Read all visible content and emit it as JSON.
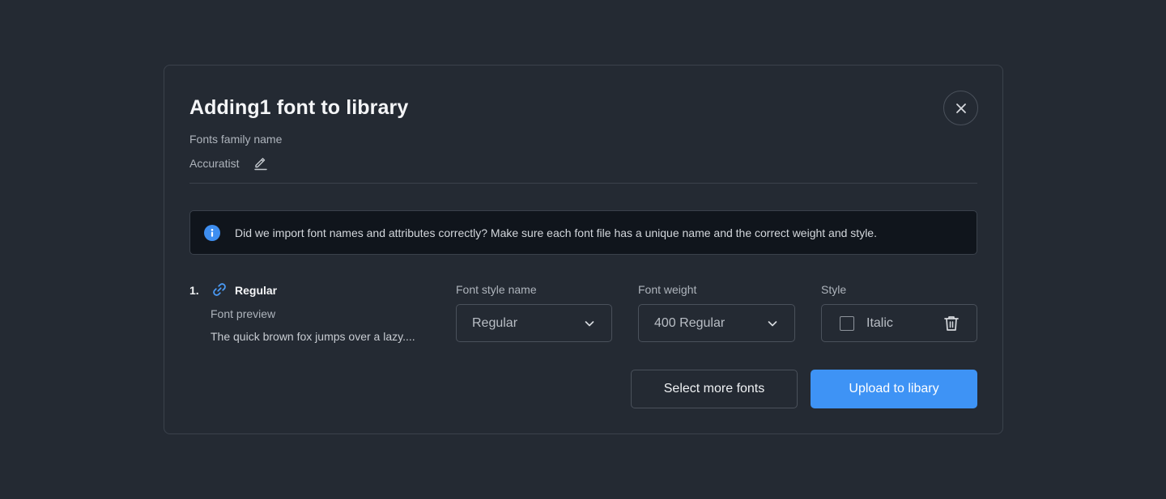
{
  "modal": {
    "title": "Adding1 font to library",
    "close_icon": "close-icon"
  },
  "family": {
    "label": "Fonts family name",
    "name": "Accuratist",
    "edit_icon": "pencil-icon"
  },
  "info": {
    "icon": "info-icon",
    "text": "Did we import font names and attributes correctly? Make sure each font file has a unique name and the correct weight and style."
  },
  "fonts": [
    {
      "number": "1.",
      "icon": "link-icon",
      "title": "Regular",
      "preview_label": "Font preview",
      "preview_text": "The quick brown fox jumps over a lazy....",
      "style_name_label": "Font style name",
      "style_name_value": "Regular",
      "weight_label": "Font weight",
      "weight_value": "400 Regular",
      "style_label": "Style",
      "italic_label": "Italic",
      "italic_checked": false,
      "delete_icon": "trash-icon"
    }
  ],
  "actions": {
    "select_more": "Select more fonts",
    "upload": "Upload to libary"
  },
  "colors": {
    "background": "#242a33",
    "primary": "#3e93f5",
    "info_bg": "#10151c"
  }
}
